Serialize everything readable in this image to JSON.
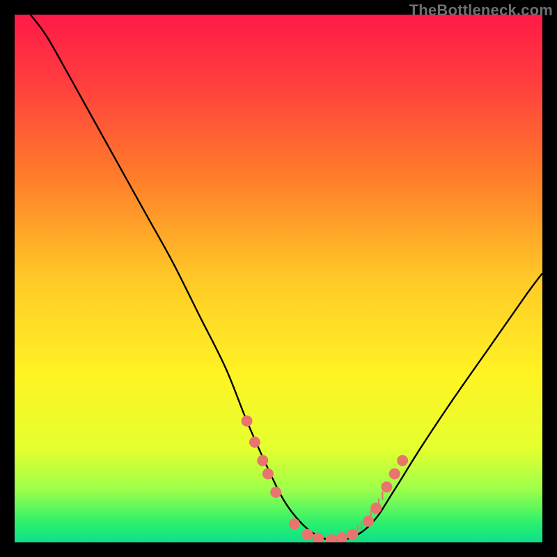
{
  "watermark": "TheBottleneck.com",
  "chart_data": {
    "type": "line",
    "title": "",
    "xlabel": "",
    "ylabel": "",
    "xlim": [
      0,
      100
    ],
    "ylim": [
      0,
      100
    ],
    "gradient_stops": [
      {
        "offset": 0.0,
        "color": "#ff1a47"
      },
      {
        "offset": 0.12,
        "color": "#ff3b3f"
      },
      {
        "offset": 0.3,
        "color": "#ff7a2b"
      },
      {
        "offset": 0.5,
        "color": "#ffc927"
      },
      {
        "offset": 0.68,
        "color": "#fff324"
      },
      {
        "offset": 0.82,
        "color": "#e6ff2e"
      },
      {
        "offset": 0.9,
        "color": "#9dff4a"
      },
      {
        "offset": 0.965,
        "color": "#29f06e"
      },
      {
        "offset": 1.0,
        "color": "#0de08a"
      }
    ],
    "series": [
      {
        "name": "bottleneck-curve",
        "x": [
          3,
          6,
          10,
          15,
          20,
          25,
          30,
          35,
          40,
          44,
          48,
          51,
          54,
          57,
          60,
          64,
          68,
          72,
          77,
          83,
          90,
          97,
          100
        ],
        "y": [
          100,
          96,
          89,
          80,
          71,
          62,
          53,
          43,
          33,
          23,
          14,
          8,
          4,
          1.5,
          0.5,
          1,
          4,
          10,
          18,
          27,
          37,
          47,
          51
        ]
      }
    ],
    "markers": {
      "name": "highlight-dots",
      "color": "#e9746e",
      "radius": 8,
      "points": [
        {
          "x": 44.0,
          "y": 23.0
        },
        {
          "x": 45.5,
          "y": 19.0
        },
        {
          "x": 47.0,
          "y": 15.5
        },
        {
          "x": 48.0,
          "y": 13.0
        },
        {
          "x": 49.5,
          "y": 9.5
        },
        {
          "x": 53.0,
          "y": 3.5
        },
        {
          "x": 55.5,
          "y": 1.5
        },
        {
          "x": 57.5,
          "y": 0.8
        },
        {
          "x": 60.0,
          "y": 0.5
        },
        {
          "x": 62.0,
          "y": 0.9
        },
        {
          "x": 64.0,
          "y": 1.5
        },
        {
          "x": 67.0,
          "y": 4.0
        },
        {
          "x": 68.5,
          "y": 6.5
        },
        {
          "x": 70.5,
          "y": 10.5
        },
        {
          "x": 72.0,
          "y": 13.0
        },
        {
          "x": 73.5,
          "y": 15.5
        }
      ]
    },
    "ticks": {
      "name": "minor-ticks",
      "color": "#e9746e",
      "points": [
        {
          "x": 65.0,
          "y": 2.5
        },
        {
          "x": 65.7,
          "y": 3.2
        },
        {
          "x": 66.3,
          "y": 4.0
        },
        {
          "x": 67.5,
          "y": 5.3
        },
        {
          "x": 68.2,
          "y": 6.1
        },
        {
          "x": 69.0,
          "y": 7.5
        },
        {
          "x": 69.7,
          "y": 8.8
        }
      ]
    }
  }
}
